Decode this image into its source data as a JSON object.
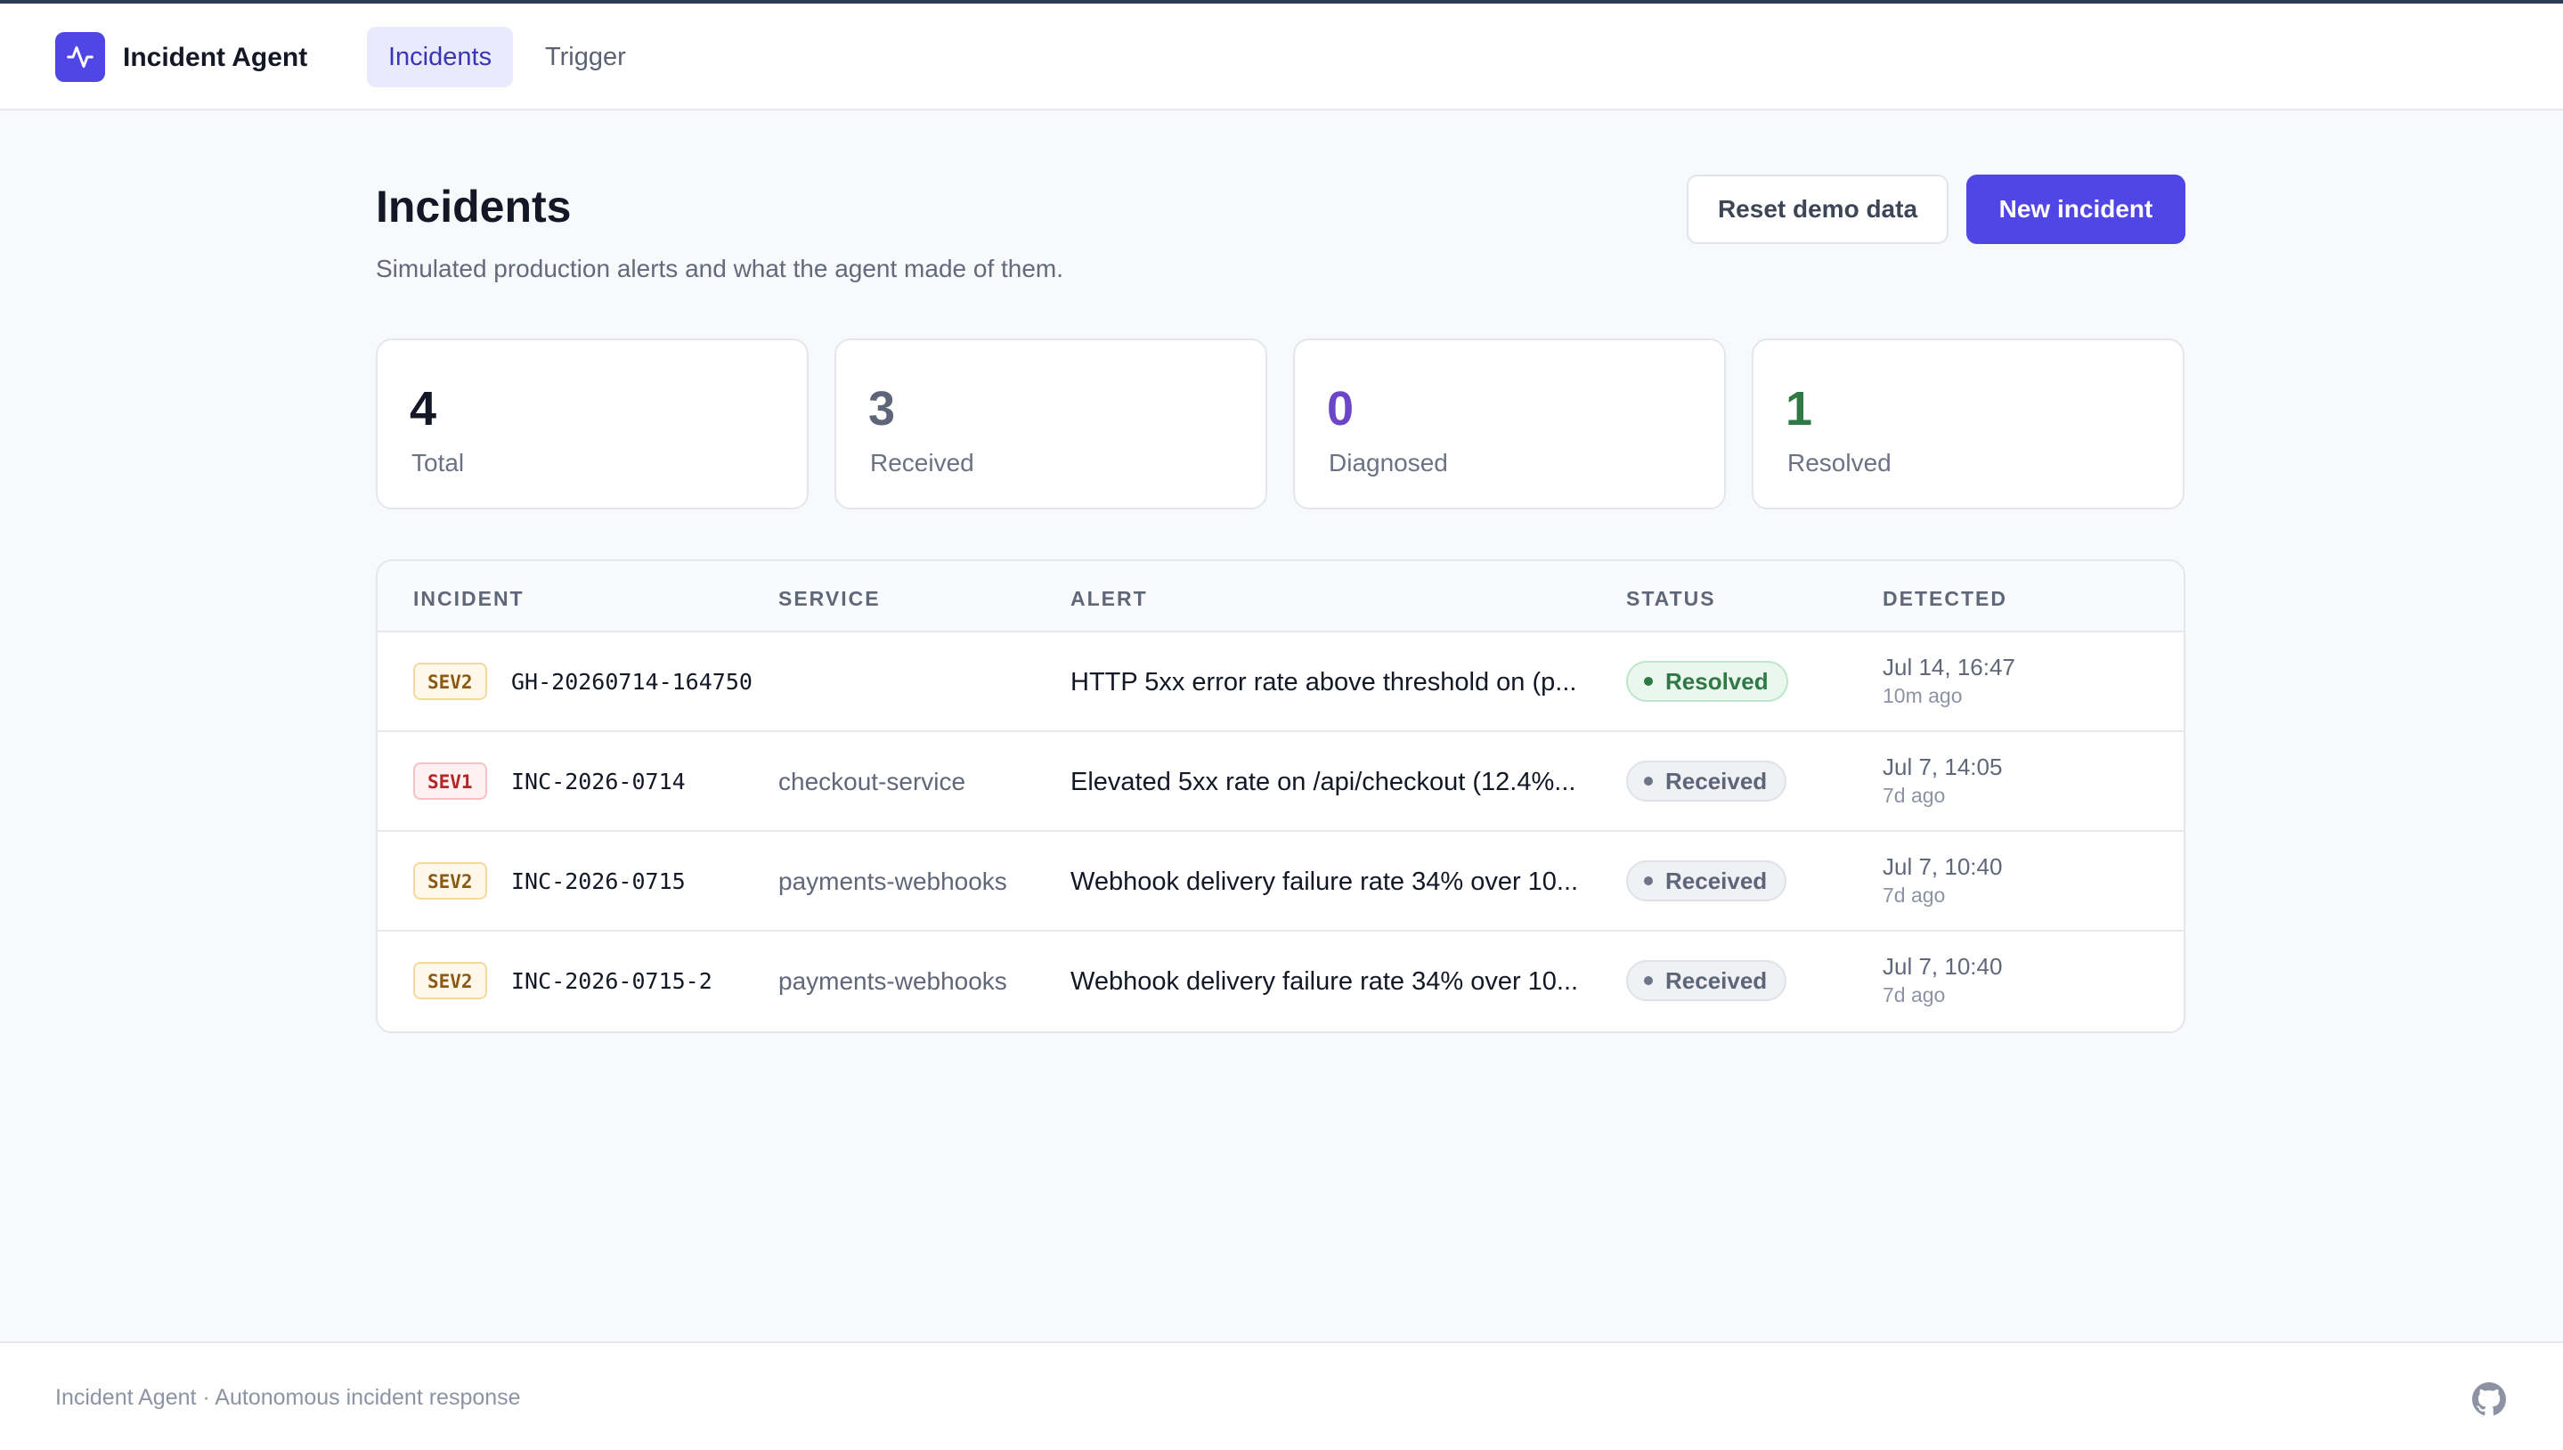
{
  "app": {
    "name": "Incident Agent",
    "logo_icon": "activity-pulse-icon",
    "accent": "#4f46e5"
  },
  "nav": {
    "tabs": [
      {
        "label": "Incidents",
        "active": true
      },
      {
        "label": "Trigger",
        "active": false
      }
    ]
  },
  "page": {
    "title": "Incidents",
    "subtitle": "Simulated production alerts and what the agent made of them.",
    "reset_label": "Reset demo data",
    "new_label": "New incident"
  },
  "stats": [
    {
      "value": "4",
      "label": "Total",
      "color": "#141826"
    },
    {
      "value": "3",
      "label": "Received",
      "color": "#5d6578"
    },
    {
      "value": "0",
      "label": "Diagnosed",
      "color": "#6b46c8"
    },
    {
      "value": "1",
      "label": "Resolved",
      "color": "#2f7a44"
    }
  ],
  "table": {
    "columns": [
      "INCIDENT",
      "SERVICE",
      "ALERT",
      "STATUS",
      "DETECTED"
    ],
    "rows": [
      {
        "severity": "SEV2",
        "id": "GH-20260714-164750",
        "service": "",
        "alert": "HTTP 5xx error rate above threshold on (p...",
        "status": "Resolved",
        "date": "Jul 14, 16:47",
        "ago": "10m ago"
      },
      {
        "severity": "SEV1",
        "id": "INC-2026-0714",
        "service": "checkout-service",
        "alert": "Elevated 5xx rate on /api/checkout (12.4%...",
        "status": "Received",
        "date": "Jul 7, 14:05",
        "ago": "7d ago"
      },
      {
        "severity": "SEV2",
        "id": "INC-2026-0715",
        "service": "payments-webhooks",
        "alert": "Webhook delivery failure rate 34% over 10...",
        "status": "Received",
        "date": "Jul 7, 10:40",
        "ago": "7d ago"
      },
      {
        "severity": "SEV2",
        "id": "INC-2026-0715-2",
        "service": "payments-webhooks",
        "alert": "Webhook delivery failure rate 34% over 10...",
        "status": "Received",
        "date": "Jul 7, 10:40",
        "ago": "7d ago"
      }
    ]
  },
  "footer": {
    "text": "Incident Agent · Autonomous incident response",
    "github_icon": "github-icon"
  }
}
